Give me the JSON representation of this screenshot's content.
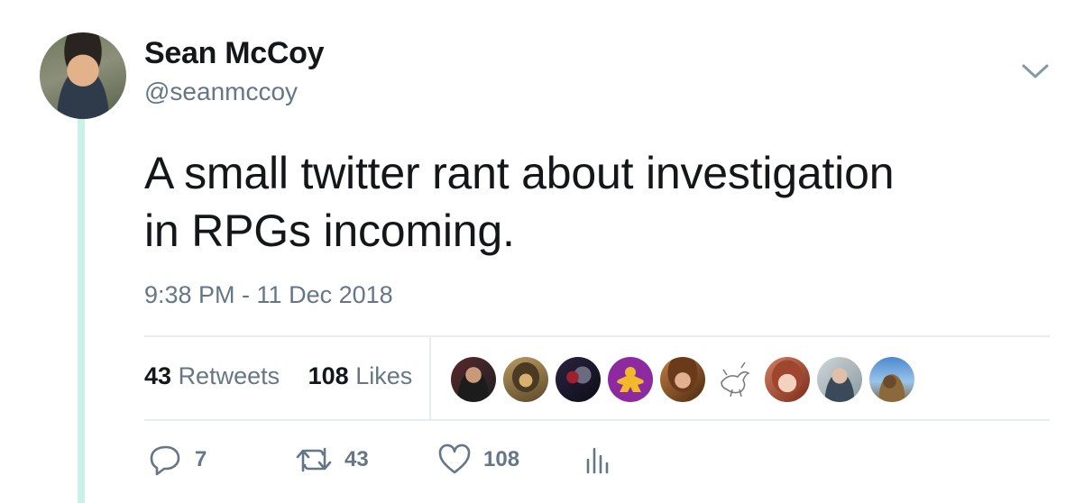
{
  "tweet": {
    "author_name": "Sean McCoy",
    "author_handle": "@seanmccoy",
    "text_line1": "A small twitter rant about investigation",
    "text_line2": "in RPGs incoming.",
    "timestamp": "9:38 PM - 11 Dec 2018"
  },
  "stats": {
    "retweets_count": "43",
    "retweets_label": "Retweets",
    "likes_count": "108",
    "likes_label": "Likes"
  },
  "likers": [
    {
      "icon": "avatar-man-dark"
    },
    {
      "icon": "avatar-hooded-figure"
    },
    {
      "icon": "avatar-dark-character"
    },
    {
      "icon": "avatar-yellow-meeple"
    },
    {
      "icon": "avatar-painted-woman"
    },
    {
      "icon": "avatar-sketch-bird"
    },
    {
      "icon": "avatar-anime-girl"
    },
    {
      "icon": "avatar-man-glasses"
    },
    {
      "icon": "avatar-landscape-tree"
    }
  ],
  "actions": {
    "reply_count": "7",
    "retweet_count": "43",
    "like_count": "108"
  },
  "colors": {
    "text": "#14171a",
    "muted": "#657786",
    "divider": "#e6ecf0",
    "thread_line": "#c9f1e8"
  }
}
